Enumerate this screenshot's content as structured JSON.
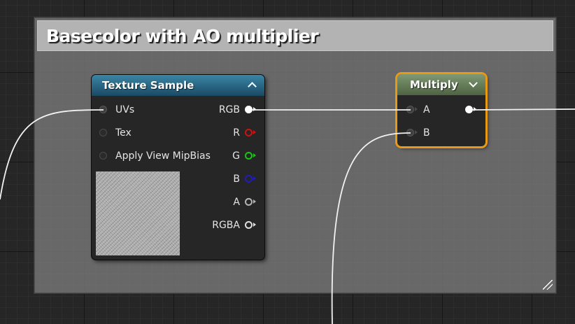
{
  "comment_box": {
    "title": "Basecolor with AO multiplier"
  },
  "texture_sample_node": {
    "title": "Texture Sample",
    "inputs": [
      {
        "label": "UVs"
      },
      {
        "label": "Tex"
      },
      {
        "label": "Apply View MipBias"
      }
    ],
    "outputs": [
      {
        "label": "RGB",
        "color": "#ffffff"
      },
      {
        "label": "R",
        "color": "#d21010"
      },
      {
        "label": "G",
        "color": "#18c418"
      },
      {
        "label": "B",
        "color": "#1c1cc8"
      },
      {
        "label": "A",
        "color": "#b4b4b4"
      },
      {
        "label": "RGBA",
        "color": "#ffffff"
      }
    ],
    "header_color": "#2d6f8f"
  },
  "multiply_node": {
    "title": "Multiply",
    "inputs": [
      {
        "label": "A"
      },
      {
        "label": "B"
      }
    ],
    "header_color": "#6a8160",
    "selection_color": "#e89a16"
  }
}
